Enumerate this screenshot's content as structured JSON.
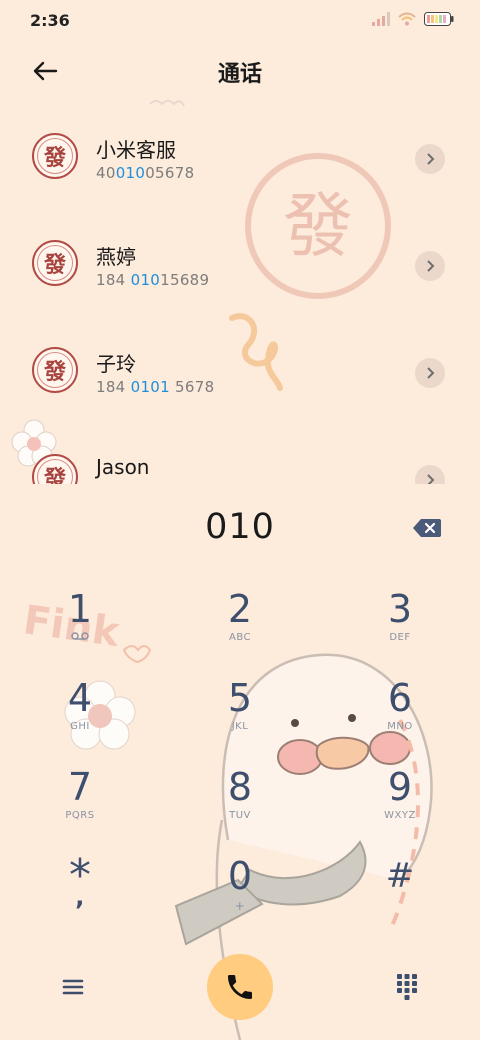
{
  "status_bar": {
    "time": "2:36"
  },
  "header": {
    "title": "通话"
  },
  "contacts": [
    {
      "name": "小米客服",
      "number_parts": [
        "40",
        "010",
        "05678"
      ],
      "avatar_char": "發"
    },
    {
      "name": "燕婷",
      "number_parts": [
        "184 ",
        "010",
        "15689"
      ],
      "avatar_char": "發"
    },
    {
      "name": "子玲",
      "number_parts": [
        "184 ",
        "0101",
        " 5678"
      ],
      "avatar_char": "發"
    },
    {
      "name": "Jason",
      "number_parts": [
        "",
        "",
        ""
      ],
      "avatar_char": "發"
    }
  ],
  "dialer": {
    "number": "010"
  },
  "keys": [
    {
      "digit": "1",
      "letters": ""
    },
    {
      "digit": "2",
      "letters": "ABC"
    },
    {
      "digit": "3",
      "letters": "DEF"
    },
    {
      "digit": "4",
      "letters": "GHI"
    },
    {
      "digit": "5",
      "letters": "JKL"
    },
    {
      "digit": "6",
      "letters": "MNO"
    },
    {
      "digit": "7",
      "letters": "PQRS"
    },
    {
      "digit": "8",
      "letters": "TUV"
    },
    {
      "digit": "9",
      "letters": "WXYZ"
    },
    {
      "digit": "*",
      "letters": ","
    },
    {
      "digit": "0",
      "letters": "+"
    },
    {
      "digit": "#",
      "letters": ""
    }
  ],
  "wallpaper": {
    "text": "Fink",
    "seal_char": "發"
  },
  "colors": {
    "background": "#FDEBDC",
    "accent": "#1e8fdc",
    "call_button": "#FFCC80",
    "key_text": "#3e4f6e"
  }
}
